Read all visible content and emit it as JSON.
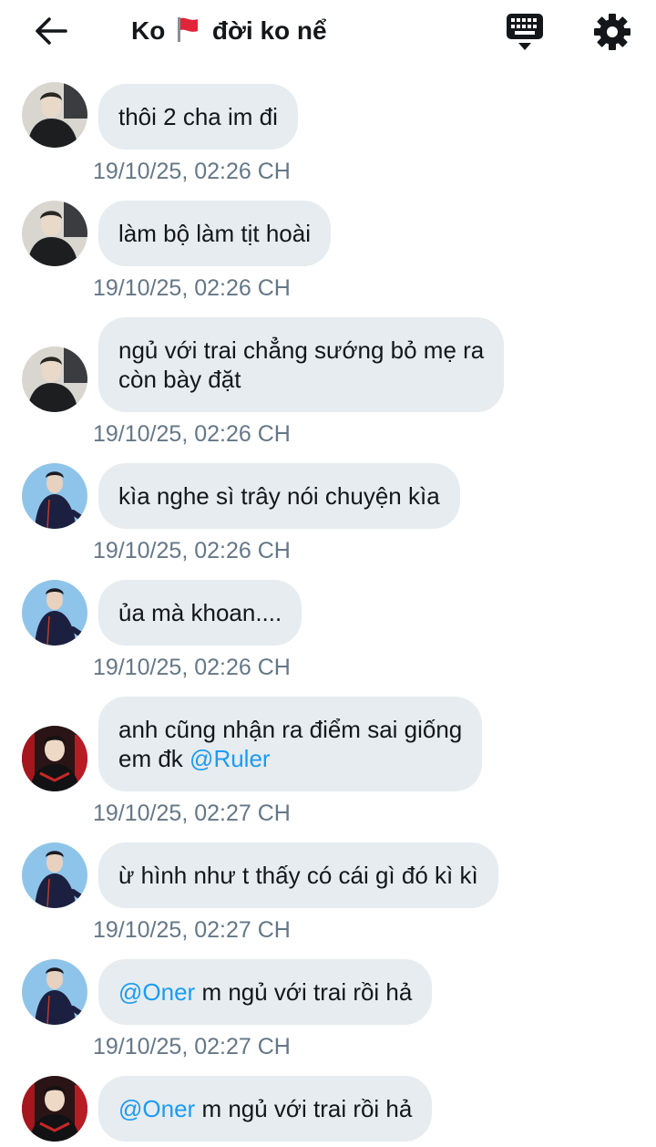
{
  "header": {
    "title_prefix": "Ko",
    "title_suffix": "đời ko nể",
    "icons": {
      "back": "arrow-left-icon",
      "flag": "red-flag-icon",
      "keyboard": "keyboard-icon",
      "settings": "gear-icon"
    }
  },
  "colors": {
    "bubble": "#e6ecf0",
    "mention": "#1d9bf0",
    "timestamp": "#657786",
    "text": "#14171a"
  },
  "messages": [
    {
      "sender": "avatar-a",
      "lines": [
        "thôi 2 cha im đi"
      ],
      "time": "19/10/25, 02:26 CH"
    },
    {
      "sender": "avatar-a",
      "lines": [
        "làm bộ làm tịt hoài"
      ],
      "time": "19/10/25, 02:26 CH"
    },
    {
      "sender": "avatar-a",
      "lines": [
        "ngủ với trai chẳng sướng bỏ mẹ ra",
        "còn bày đặt"
      ],
      "time": "19/10/25, 02:26 CH"
    },
    {
      "sender": "avatar-b",
      "lines": [
        "kìa nghe sì trây nói chuyện kìa"
      ],
      "time": "19/10/25, 02:26 CH"
    },
    {
      "sender": "avatar-b",
      "lines": [
        "ủa mà khoan...."
      ],
      "time": "19/10/25, 02:26 CH"
    },
    {
      "sender": "avatar-c",
      "lines": [
        "anh cũng nhận ra điểm sai giống",
        "em đk"
      ],
      "mention": "@Ruler",
      "time": "19/10/25, 02:27 CH"
    },
    {
      "sender": "avatar-b",
      "lines": [
        "ừ hình như t thấy có cái gì đó kì kì"
      ],
      "time": "19/10/25, 02:27 CH"
    },
    {
      "sender": "avatar-b",
      "mention": "@Oner",
      "lines": [
        "m ngủ với trai rồi hả"
      ],
      "time": "19/10/25, 02:27 CH"
    },
    {
      "sender": "avatar-c",
      "mention": "@Oner",
      "lines": [
        "m ngủ với trai rồi hả"
      ]
    }
  ]
}
